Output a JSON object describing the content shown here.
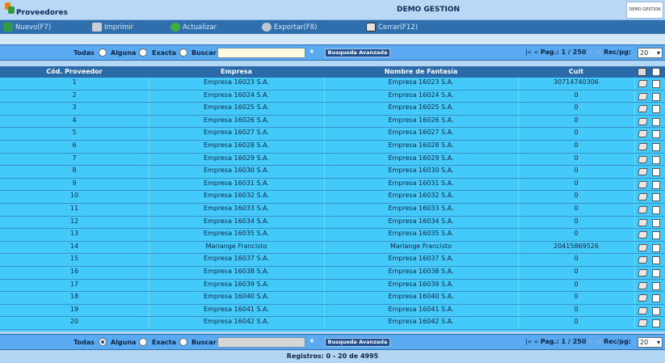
{
  "header": {
    "title": "Proveedores",
    "company": "DEMO GESTION",
    "logo_text": "DEMO GESTION"
  },
  "toolbar": {
    "nuevo": "Nuevo(F7)",
    "imprimir": "Imprimir",
    "actualizar": "Actualizar",
    "exportar": "Exportar(F8)",
    "cerrar": "Cerrar(F12)"
  },
  "search_top": {
    "todas": "Todas",
    "alguna": "Alguna",
    "exacta": "Exacta",
    "buscar": "Buscar",
    "value": "",
    "selected": "none",
    "advanced": "Busqueda Avanzada"
  },
  "search_bottom": {
    "todas": "Todas",
    "alguna": "Alguna",
    "exacta": "Exacta",
    "buscar": "Buscar",
    "value": "",
    "selected": "alguna",
    "advanced": "Busqueda Avanzada"
  },
  "pager": {
    "label": "Pag.:",
    "current": "1 / 250",
    "rec_label": "Rec/pg:",
    "rec_value": "20"
  },
  "table": {
    "columns": [
      "Cód. Proveedor",
      "Empresa",
      "Nombre de Fantasía",
      "Cuit"
    ],
    "rows": [
      [
        "1",
        "Empresa 16023 S.A.",
        "Empresa 16023 S.A.",
        "30714740306"
      ],
      [
        "2",
        "Empresa 16024 S.A.",
        "Empresa 16024 S.A.",
        "0"
      ],
      [
        "3",
        "Empresa 16025 S.A.",
        "Empresa 16025 S.A.",
        "0"
      ],
      [
        "4",
        "Empresa 16026 S.A.",
        "Empresa 16026 S.A.",
        "0"
      ],
      [
        "5",
        "Empresa 16027 S.A.",
        "Empresa 16027 S.A.",
        "0"
      ],
      [
        "6",
        "Empresa 16028 S.A.",
        "Empresa 16028 S.A.",
        "0"
      ],
      [
        "7",
        "Empresa 16029 S.A.",
        "Empresa 16029 S.A.",
        "0"
      ],
      [
        "8",
        "Empresa 16030 S.A.",
        "Empresa 16030 S.A.",
        "0"
      ],
      [
        "9",
        "Empresa 16031 S.A.",
        "Empresa 16031 S.A.",
        "0"
      ],
      [
        "10",
        "Empresa 16032 S.A.",
        "Empresa 16032 S.A.",
        "0"
      ],
      [
        "11",
        "Empresa 16033 S.A.",
        "Empresa 16033 S.A.",
        "0"
      ],
      [
        "12",
        "Empresa 16034 S.A.",
        "Empresa 16034 S.A.",
        "0"
      ],
      [
        "13",
        "Empresa 16035 S.A.",
        "Empresa 16035 S.A.",
        "0"
      ],
      [
        "14",
        "Mariange Francisto",
        "Mariange Francisto",
        "20415869526"
      ],
      [
        "15",
        "Empresa 16037 S.A.",
        "Empresa 16037 S.A.",
        "0"
      ],
      [
        "16",
        "Empresa 16038 S.A.",
        "Empresa 16038 S.A.",
        "0"
      ],
      [
        "17",
        "Empresa 16039 S.A.",
        "Empresa 16039 S.A.",
        "0"
      ],
      [
        "18",
        "Empresa 16040 S.A.",
        "Empresa 16040 S.A.",
        "0"
      ],
      [
        "19",
        "Empresa 16041 S.A.",
        "Empresa 16041 S.A.",
        "0"
      ],
      [
        "20",
        "Empresa 16042 S.A.",
        "Empresa 16042 S.A.",
        "0"
      ]
    ]
  },
  "footer": {
    "text": "Registros: 0 - 20 de 4995"
  },
  "icons": {
    "app": "folder-app-icon",
    "nuevo": "globe-add-icon",
    "imprimir": "printer-icon",
    "actualizar": "refresh-icon",
    "exportar": "export-icon",
    "cerrar": "exit-door-icon",
    "edit": "edit-icon",
    "search_wand": "magic-wand-icon"
  },
  "colors": {
    "toolbar": "#2f6fae",
    "grid_row": "#44cafa",
    "grid_header": "#2b6aa8",
    "searchbar": "#5aaaf2"
  }
}
